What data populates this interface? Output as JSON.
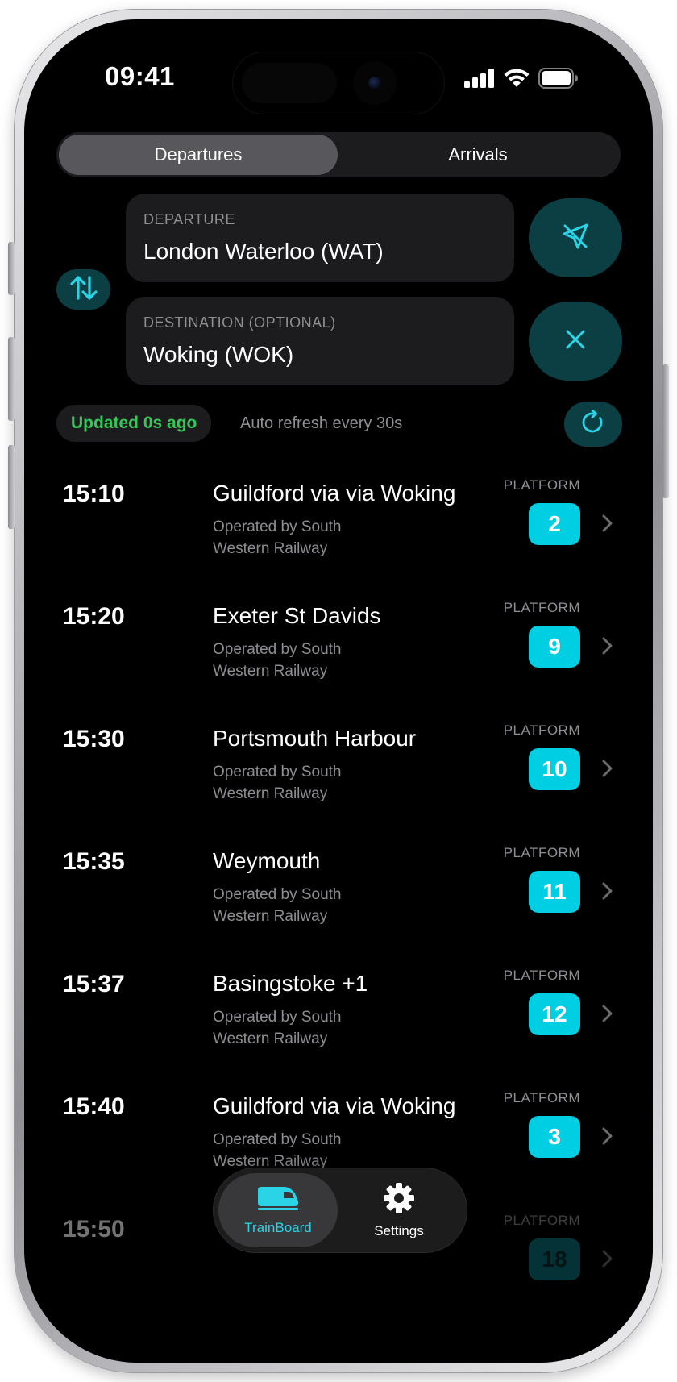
{
  "status_bar": {
    "time": "09:41"
  },
  "segmented": {
    "departures": "Departures",
    "arrivals": "Arrivals",
    "selected": "Departures"
  },
  "departure_field": {
    "label": "DEPARTURE",
    "value": "London Waterloo (WAT)"
  },
  "destination_field": {
    "label": "DESTINATION (OPTIONAL)",
    "value": "Woking (WOK)"
  },
  "refresh": {
    "updated": "Updated 0s ago",
    "auto": "Auto refresh every 30s"
  },
  "list": {
    "platform_label": "PLATFORM"
  },
  "departures": [
    {
      "time": "15:10",
      "destination": "Guildford via via Woking",
      "operator": "Operated by South Western Railway",
      "platform": "2"
    },
    {
      "time": "15:20",
      "destination": "Exeter St Davids",
      "operator": "Operated by South Western Railway",
      "platform": "9"
    },
    {
      "time": "15:30",
      "destination": "Portsmouth Harbour",
      "operator": "Operated by South Western Railway",
      "platform": "10"
    },
    {
      "time": "15:35",
      "destination": "Weymouth",
      "operator": "Operated by South Western Railway",
      "platform": "11"
    },
    {
      "time": "15:37",
      "destination": "Basingstoke +1",
      "operator": "Operated by South Western Railway",
      "platform": "12"
    },
    {
      "time": "15:40",
      "destination": "Guildford via via Woking",
      "operator": "Operated by South Western Railway",
      "platform": "3"
    },
    {
      "time": "15:50",
      "destination": "",
      "operator": "",
      "platform": "18"
    }
  ],
  "tabbar": {
    "trainboard": "TrainBoard",
    "settings": "Settings",
    "active": "TrainBoard"
  },
  "colors": {
    "accent": "#00cfe3",
    "accent_dark": "#0b3f44",
    "updated_green": "#34c759",
    "background": "#000000",
    "card": "#1c1c1e"
  },
  "icons": [
    "signal-icon",
    "wifi-icon",
    "battery-icon",
    "swap-icon",
    "location-off-icon",
    "close-icon",
    "refresh-icon",
    "chevron-right-icon",
    "train-icon",
    "gear-icon"
  ]
}
